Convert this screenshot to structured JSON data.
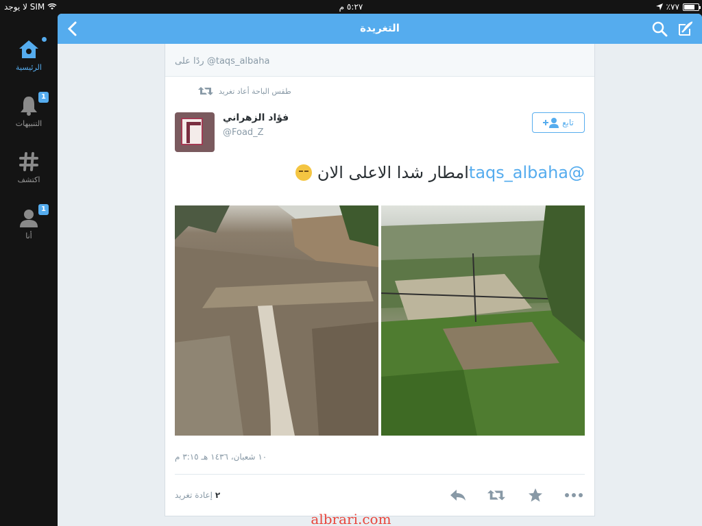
{
  "status_bar": {
    "carrier": "لا يوجد SIM",
    "time": "٥:٢٧ م",
    "battery": "٪٧٧",
    "battery_level": 0.77
  },
  "sidebar": {
    "items": [
      {
        "label": "الرئيسية",
        "icon": "home-icon",
        "active": true,
        "badge": "",
        "dot": true
      },
      {
        "label": "التنبيهات",
        "icon": "bell-icon",
        "active": false,
        "badge": "1"
      },
      {
        "label": "اكتشف",
        "icon": "hashtag-icon",
        "active": false,
        "badge": ""
      },
      {
        "label": "أنا",
        "icon": "profile-icon",
        "active": false,
        "badge": "1"
      }
    ]
  },
  "header": {
    "title": "التغريدة"
  },
  "tweet": {
    "replying_to": "ردًا على @taqs_albaha",
    "retweeted_by": "طقس الباحة أعاد تغريد",
    "author_name": "فؤاد الزهراني",
    "author_handle": "@Foad_Z",
    "follow_label": "تابع",
    "text_mention": "@taqs_albaha",
    "text_body": "امطار شدا الاعلى الان",
    "timestamp": "١٠ شعبان، ١٤٣٦ هـ ٣:١٥ م",
    "retweet_count": "٢",
    "retweet_label": "إعادة تغريد"
  },
  "watermark": "albrari.com",
  "colors": {
    "accent": "#55acee",
    "sidebar_bg": "#141414",
    "panel_bg": "#e9eef2",
    "muted_text": "#8899a6",
    "watermark": "#e8463c"
  }
}
